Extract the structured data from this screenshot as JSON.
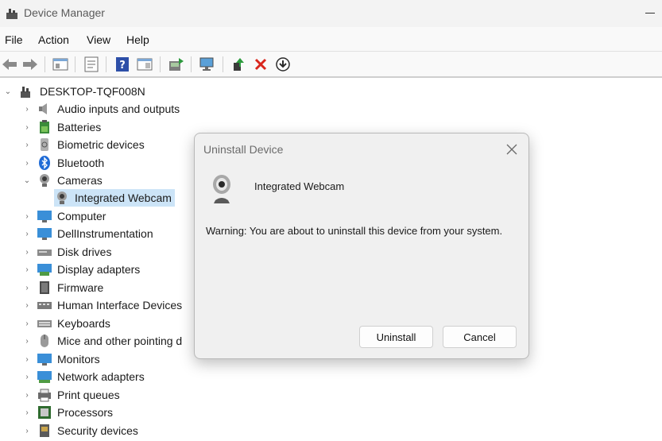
{
  "window": {
    "title": "Device Manager"
  },
  "menu": {
    "items": [
      "File",
      "Action",
      "View",
      "Help"
    ]
  },
  "toolbar": {
    "buttons": [
      "back-arrow-icon",
      "forward-arrow-icon",
      "show-hide-tree-icon",
      "properties-icon",
      "help-icon",
      "action-view-icon",
      "update-driver-icon",
      "scan-hardware-icon",
      "enable-device-icon",
      "uninstall-x-icon",
      "download-driver-icon"
    ]
  },
  "tree": {
    "root": "DESKTOP-TQF008N",
    "items": [
      {
        "label": "Audio inputs and outputs",
        "icon": "speaker-icon"
      },
      {
        "label": "Batteries",
        "icon": "battery-icon"
      },
      {
        "label": "Biometric devices",
        "icon": "fingerprint-icon"
      },
      {
        "label": "Bluetooth",
        "icon": "bluetooth-icon"
      },
      {
        "label": "Cameras",
        "icon": "camera-icon",
        "expanded": true
      },
      {
        "label": "Integrated Webcam",
        "icon": "webcam-icon",
        "child": true,
        "selected": true
      },
      {
        "label": "Computer",
        "icon": "computer-icon"
      },
      {
        "label": "DellInstrumentation",
        "icon": "monitor-icon"
      },
      {
        "label": "Disk drives",
        "icon": "disk-drive-icon"
      },
      {
        "label": "Display adapters",
        "icon": "display-adapter-icon"
      },
      {
        "label": "Firmware",
        "icon": "firmware-icon"
      },
      {
        "label": "Human Interface Devices",
        "icon": "hid-icon"
      },
      {
        "label": "Keyboards",
        "icon": "keyboard-icon"
      },
      {
        "label": "Mice and other pointing d",
        "icon": "mouse-icon"
      },
      {
        "label": "Monitors",
        "icon": "monitor-icon"
      },
      {
        "label": "Network adapters",
        "icon": "network-adapter-icon"
      },
      {
        "label": "Print queues",
        "icon": "printer-icon"
      },
      {
        "label": "Processors",
        "icon": "processor-icon"
      },
      {
        "label": "Security devices",
        "icon": "security-device-icon"
      }
    ]
  },
  "dialog": {
    "title": "Uninstall Device",
    "device_name": "Integrated Webcam",
    "warning": "Warning: You are about to uninstall this device from your system.",
    "uninstall_label": "Uninstall",
    "cancel_label": "Cancel"
  },
  "colors": {
    "selection": "#cce4f7",
    "dialog_bg": "#f0f0f0",
    "uninstall_red": "#d9261c"
  }
}
